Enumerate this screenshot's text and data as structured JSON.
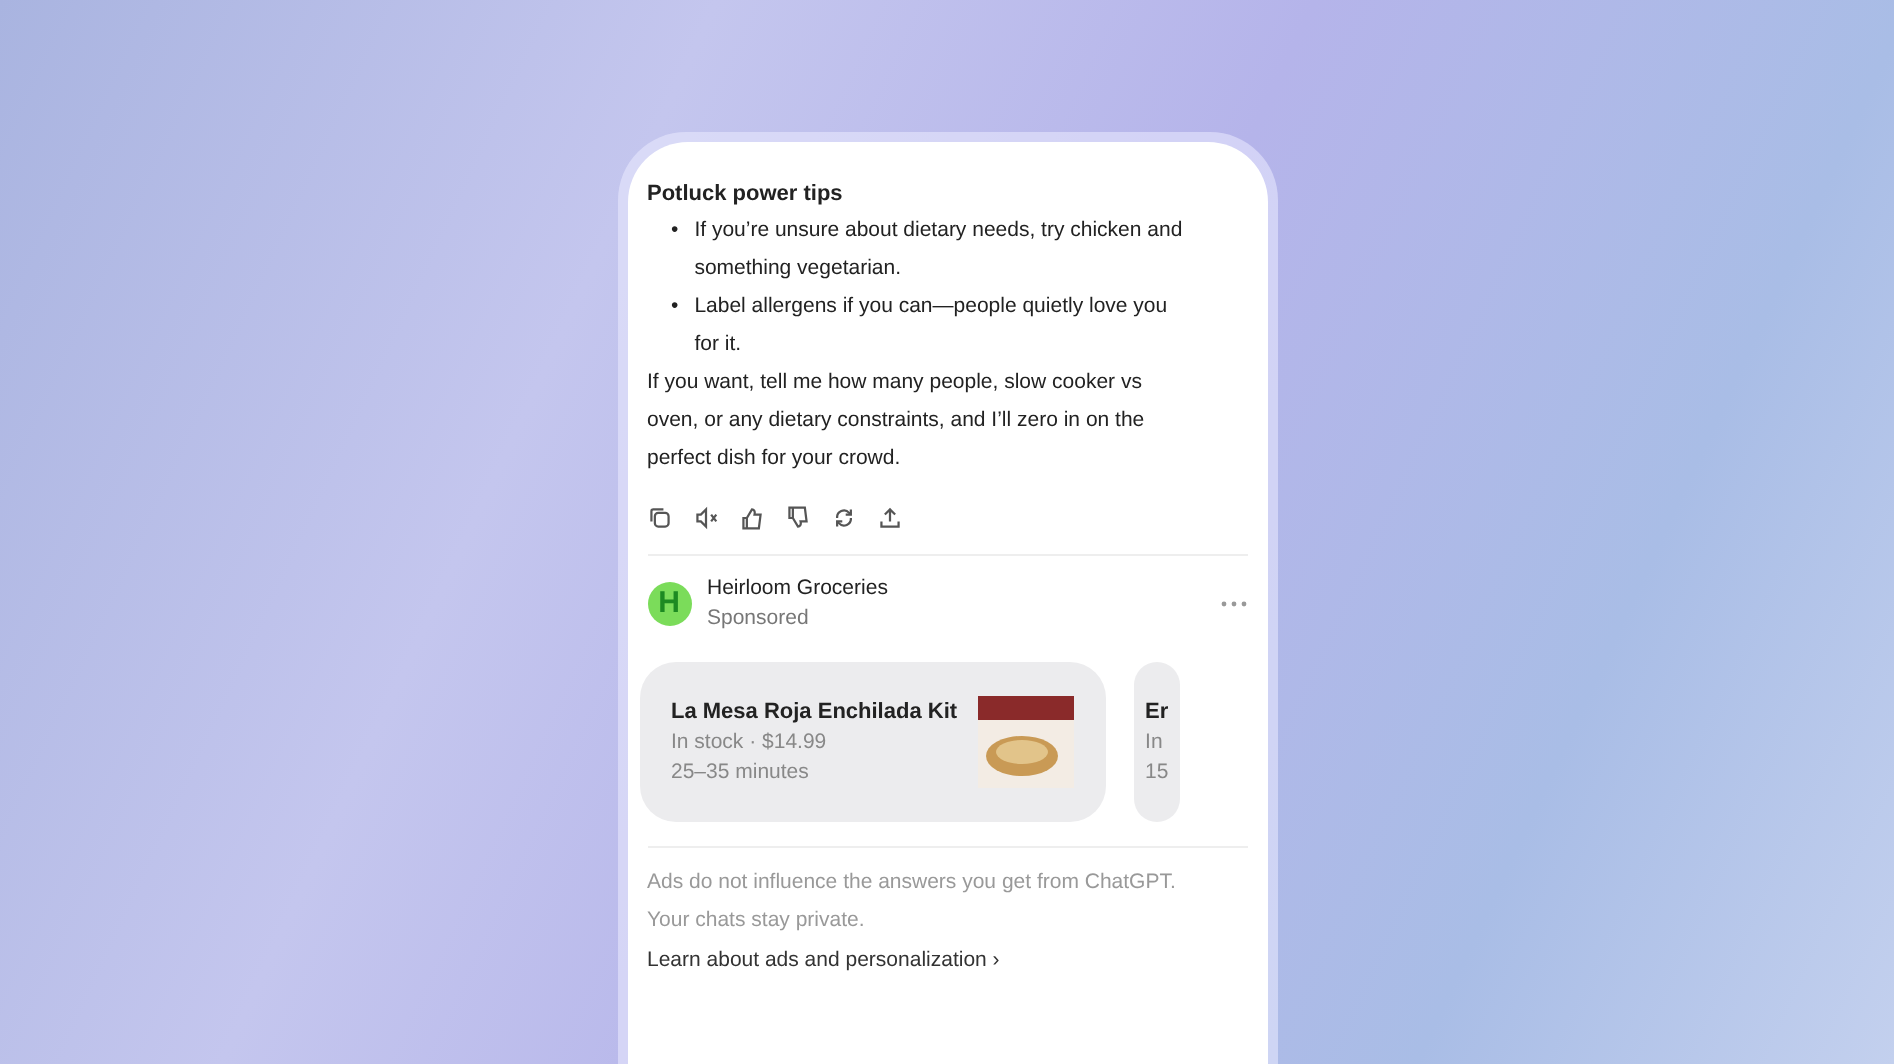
{
  "message": {
    "title": "Potluck power tips",
    "marker": "•",
    "bullets": [
      "If you’re unsure about dietary needs, try chicken and something vegetarian.",
      "Label allergens if you can—people quietly love you for it."
    ],
    "paragraph": "If you want, tell me how many people, slow cooker vs oven, or any dietary constraints, and I’ll zero in on the perfect dish for your crowd."
  },
  "ad": {
    "advertiser": "Heirloom Groceries",
    "label": "Sponsored",
    "logo_letter": "H",
    "products": [
      {
        "name": "La Mesa Roja Enchilada Kit",
        "availability": "In stock · $14.99",
        "time": "25–35 minutes",
        "image": true
      },
      {
        "name": "Er",
        "availability": "In",
        "time": "15",
        "image": false
      }
    ]
  },
  "disclaimer": "Ads do not influence the answers you get from ChatGPT. Your chats stay private.",
  "link": {
    "label": "Learn about ads and personalization",
    "arrow": "›"
  }
}
